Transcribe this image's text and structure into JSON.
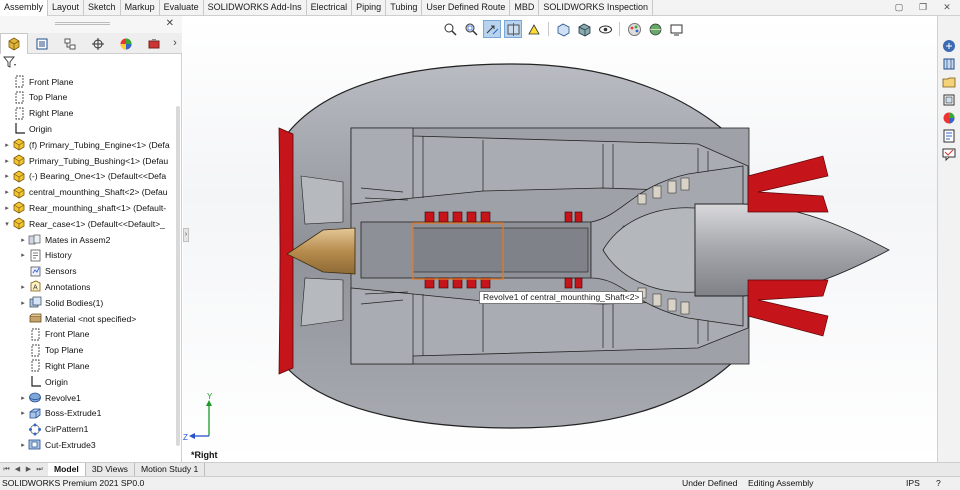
{
  "command_tabs": [
    "Assembly",
    "Layout",
    "Sketch",
    "Markup",
    "Evaluate",
    "SOLIDWORKS Add-Ins",
    "Electrical",
    "Piping",
    "Tubing",
    "User Defined Route",
    "MBD",
    "SOLIDWORKS Inspection"
  ],
  "active_command_tab": "Assembly",
  "feature_manager": {
    "filter_icon": "filter-icon",
    "panel_tabs": [
      "feature-manager-tree-icon",
      "property-manager-icon",
      "configuration-manager-icon",
      "dimxpert-manager-icon",
      "display-manager-icon",
      "cam-manager-icon"
    ],
    "tree": [
      {
        "label": "Front Plane",
        "icon": "plane-icon",
        "level": 0,
        "expander": ""
      },
      {
        "label": "Top Plane",
        "icon": "plane-icon",
        "level": 0,
        "expander": ""
      },
      {
        "label": "Right Plane",
        "icon": "plane-icon",
        "level": 0,
        "expander": ""
      },
      {
        "label": "Origin",
        "icon": "origin-icon",
        "level": 0,
        "expander": ""
      },
      {
        "label": "(f) Primary_Tubing_Engine<1> (Defa",
        "icon": "part-icon",
        "level": 0,
        "expander": "▸"
      },
      {
        "label": "Primary_Tubing_Bushing<1> (Defau",
        "icon": "part-icon",
        "level": 0,
        "expander": "▸"
      },
      {
        "label": "(-) Bearing_One<1> (Default<<Defa",
        "icon": "part-icon",
        "level": 0,
        "expander": "▸"
      },
      {
        "label": "central_mounthing_Shaft<2> (Defau",
        "icon": "part-icon",
        "level": 0,
        "expander": "▸"
      },
      {
        "label": "Rear_mounthing_shaft<1> (Default-",
        "icon": "part-icon",
        "level": 0,
        "expander": "▸"
      },
      {
        "label": "Rear_case<1> (Default<<Default>_",
        "icon": "part-icon",
        "level": 0,
        "expander": "▾"
      },
      {
        "label": "Mates in Assem2",
        "icon": "mates-icon",
        "level": 1,
        "expander": "▸"
      },
      {
        "label": "History",
        "icon": "history-icon",
        "level": 1,
        "expander": "▸"
      },
      {
        "label": "Sensors",
        "icon": "sensors-icon",
        "level": 1,
        "expander": ""
      },
      {
        "label": "Annotations",
        "icon": "annotations-icon",
        "level": 1,
        "expander": "▸"
      },
      {
        "label": "Solid Bodies(1)",
        "icon": "solid-bodies-icon",
        "level": 1,
        "expander": "▸"
      },
      {
        "label": "Material <not specified>",
        "icon": "material-icon",
        "level": 1,
        "expander": ""
      },
      {
        "label": "Front Plane",
        "icon": "plane-icon",
        "level": 1,
        "expander": ""
      },
      {
        "label": "Top Plane",
        "icon": "plane-icon",
        "level": 1,
        "expander": ""
      },
      {
        "label": "Right Plane",
        "icon": "plane-icon",
        "level": 1,
        "expander": ""
      },
      {
        "label": "Origin",
        "icon": "origin-icon",
        "level": 1,
        "expander": ""
      },
      {
        "label": "Revolve1",
        "icon": "revolve-icon",
        "level": 1,
        "expander": "▸"
      },
      {
        "label": "Boss-Extrude1",
        "icon": "extrude-icon",
        "level": 1,
        "expander": "▸"
      },
      {
        "label": "CirPattern1",
        "icon": "pattern-icon",
        "level": 1,
        "expander": ""
      },
      {
        "label": "Cut-Extrude3",
        "icon": "cut-icon",
        "level": 1,
        "expander": "▸"
      }
    ]
  },
  "heads_up_toolbar": [
    "zoom-to-fit-icon",
    "zoom-to-area-icon",
    "previous-view-icon",
    "section-view-icon",
    "dynamic-annotation-icon",
    "view-orientation-icon",
    "display-style-icon",
    "hide-show-icon",
    "edit-appearance-icon",
    "apply-scene-icon",
    "view-settings-icon"
  ],
  "graphics": {
    "tooltip": "Revolve1 of central_mounthing_Shaft<2>",
    "view_label": "*Right",
    "triad": {
      "y": "Y",
      "z": "Z"
    },
    "colors": {
      "shell": "#9b9ea5",
      "flange": "#c5141a",
      "spinner": "#c8a36b",
      "highlight": "#e07a2a"
    }
  },
  "task_pane": [
    "solidworks-resources-icon",
    "design-library-icon",
    "file-explorer-icon",
    "view-palette-icon",
    "appearances-icon",
    "custom-properties-icon",
    "solidworks-forum-icon"
  ],
  "bottom_tabs": [
    "Model",
    "3D Views",
    "Motion Study 1"
  ],
  "active_bottom_tab": "Model",
  "status": {
    "app": "SOLIDWORKS Premium 2021 SP0.0",
    "definition": "Under Defined",
    "mode": "Editing Assembly",
    "units": "IPS"
  }
}
